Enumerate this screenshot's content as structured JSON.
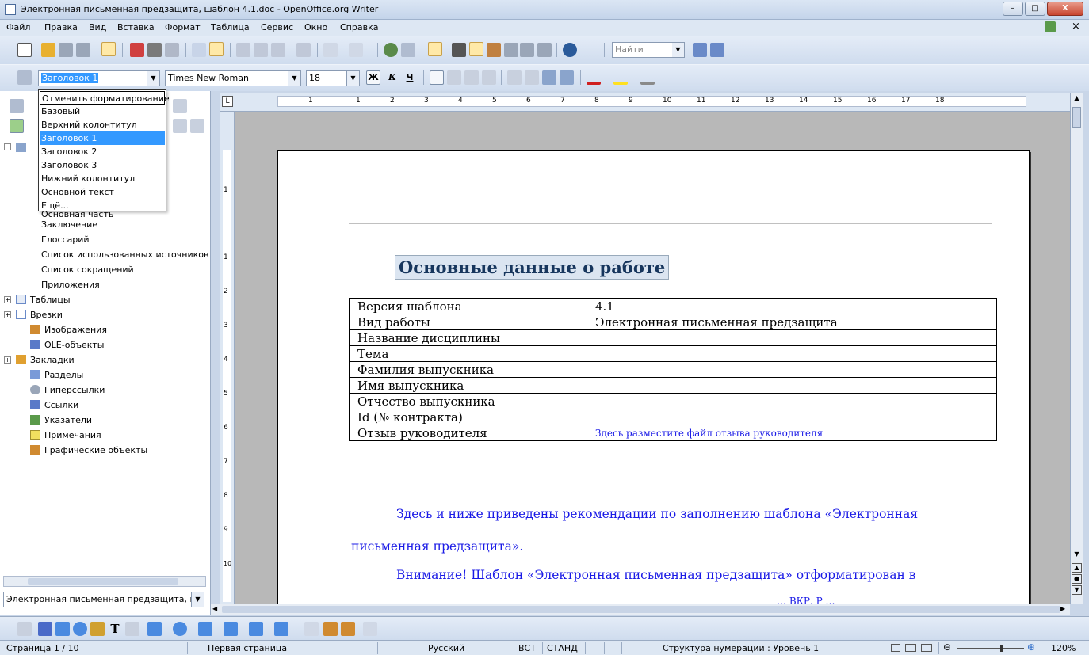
{
  "window": {
    "title": "Электронная письменная предзащита, шаблон 4.1.doc - OpenOffice.org Writer",
    "controls": {
      "minimize": "–",
      "maximize": "□",
      "close": "X"
    }
  },
  "menu": [
    "Файл",
    "Правка",
    "Вид",
    "Вставка",
    "Формат",
    "Таблица",
    "Сервис",
    "Окно",
    "Справка"
  ],
  "toolbar": {
    "find_placeholder": "Найти",
    "style_value": "Заголовок 1",
    "font_value": "Times New Roman",
    "size_value": "18",
    "bold": "Ж",
    "italic": "К",
    "underline": "Ч"
  },
  "style_dropdown": {
    "items": [
      "Отменить форматирование",
      "Базовый",
      "Верхний колонтитул",
      "Заголовок 1",
      "Заголовок 2",
      "Заголовок 3",
      "Нижний колонтитул",
      "Основной текст",
      "Ещё..."
    ],
    "selected": "Заголовок 1"
  },
  "navigator": {
    "headings_children_partial": "Основная часть",
    "headings_children": [
      "Заключение",
      "Глоссарий",
      "Список использованных источников",
      "Список сокращений",
      "Приложения"
    ],
    "categories": [
      {
        "label": "Таблицы",
        "icon": "table-icon",
        "expandable": true
      },
      {
        "label": "Врезки",
        "icon": "frame-icon",
        "expandable": true
      },
      {
        "label": "Изображения",
        "icon": "image-icon",
        "expandable": false
      },
      {
        "label": "OLE-объекты",
        "icon": "ole-icon",
        "expandable": false
      },
      {
        "label": "Закладки",
        "icon": "bookmark-icon",
        "expandable": true
      },
      {
        "label": "Разделы",
        "icon": "section-icon",
        "expandable": false
      },
      {
        "label": "Гиперссылки",
        "icon": "hyperlink-icon",
        "expandable": false
      },
      {
        "label": "Ссылки",
        "icon": "reference-icon",
        "expandable": false
      },
      {
        "label": "Указатели",
        "icon": "index-icon",
        "expandable": false
      },
      {
        "label": "Примечания",
        "icon": "note-icon",
        "expandable": false
      },
      {
        "label": "Графические объекты",
        "icon": "drawing-icon",
        "expandable": false
      }
    ],
    "document_select": "Электронная письменная предзащита, ш"
  },
  "document": {
    "heading": "Основные данные о работе",
    "table": [
      [
        "Версия шаблона",
        "4.1"
      ],
      [
        "Вид работы",
        "Электронная письменная предзащита"
      ],
      [
        "Название дисциплины",
        ""
      ],
      [
        "Тема",
        ""
      ],
      [
        "Фамилия выпускника",
        ""
      ],
      [
        "Имя выпускника",
        ""
      ],
      [
        "Отчество выпускника",
        ""
      ],
      [
        "Id (№ контракта)",
        ""
      ],
      [
        "Отзыв руководителя",
        "Здесь разместите файл отзыва руководителя"
      ]
    ],
    "paragraph1_line1": "Здесь и ниже приведены рекомендации по заполнению шаблона «Электронная",
    "paragraph1_line2": "письменная предзащита».",
    "paragraph2_line1": "Внимание! Шаблон «Электронная письменная предзащита» отформатирован в",
    "paragraph2_partial": "… ВКР. Р …"
  },
  "ruler": {
    "h_labels": [
      "1",
      "1",
      "2",
      "3",
      "4",
      "5",
      "6",
      "7",
      "8",
      "9",
      "10",
      "11",
      "12",
      "13",
      "14",
      "15",
      "16",
      "17",
      "18"
    ],
    "v_labels": [
      "1",
      "1",
      "2",
      "3",
      "4",
      "5",
      "6",
      "7",
      "8",
      "9",
      "10"
    ]
  },
  "status": {
    "page": "Страница  1 / 10",
    "page_style": "Первая страница",
    "language": "Русский",
    "insert_mode": "ВСТ",
    "selection_mode": "СТАНД",
    "numbering": "Структура нумерации : Уровень  1",
    "zoom": "120%"
  },
  "colors": {
    "accent_blue": "#1a1ae6",
    "heading_text": "#17365d",
    "selection": "#3399ff"
  }
}
